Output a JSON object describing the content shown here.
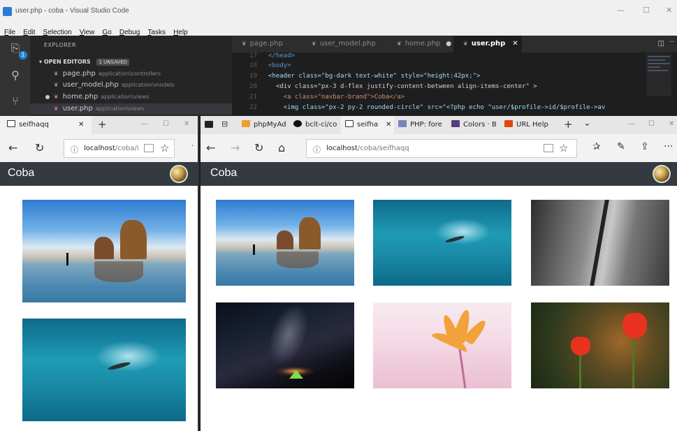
{
  "vscode": {
    "title": "user.php - coba - Visual Studio Code",
    "window_controls": [
      "—",
      "☐",
      "✕"
    ],
    "menu": [
      "File",
      "Edit",
      "Selection",
      "View",
      "Go",
      "Debug",
      "Tasks",
      "Help"
    ],
    "activity_badge": "1",
    "explorer": {
      "header": "EXPLORER",
      "section": "OPEN EDITORS",
      "unsaved_badge": "1 UNSAVED",
      "files": [
        {
          "name": "page.php",
          "path": "application\\controllers"
        },
        {
          "name": "user_model.php",
          "path": "application\\models"
        },
        {
          "name": "home.php",
          "path": "application\\views"
        },
        {
          "name": "user.php",
          "path": "application\\views"
        }
      ]
    },
    "tabs": [
      {
        "label": "page.php"
      },
      {
        "label": "user_model.php"
      },
      {
        "label": "home.php",
        "modified_marker": "●"
      },
      {
        "label": "user.php",
        "close_marker": "✕"
      }
    ],
    "code_lines": [
      {
        "num": "17",
        "code": "</head>"
      },
      {
        "num": "18",
        "code": "<body>"
      },
      {
        "num": "19",
        "code": "<header class=\"bg-dark text-white\" style=\"height:42px;\">"
      },
      {
        "num": "20",
        "code": "  <div class=\"px-3 d-flex justify-content-between align-items-center\" >"
      },
      {
        "num": "21",
        "code": "    <a class=\"navbar-brand\">Coba</a>"
      },
      {
        "num": "22",
        "code": "    <img class=\"px-2 py-2 rounded-circle\" src=\"<?php echo \"user/$profile->id/$profile->av"
      }
    ]
  },
  "left_browser": {
    "tab_title": "seifhaqq",
    "new_tab": "+",
    "window_controls": [
      "—",
      "☐",
      "✕"
    ],
    "address_host": "localhost",
    "address_path": "/coba/i",
    "navbar_brand": "Coba"
  },
  "right_browser": {
    "tabs": [
      "phpMyAd",
      "bcit-ci/co",
      "seifha",
      "PHP: fore",
      "Colors · B",
      "URL Help"
    ],
    "active_tab_close": "✕",
    "new_tab": "+",
    "tab_dropdown": "⌄",
    "window_controls": [
      "—",
      "☐",
      "✕"
    ],
    "address_host": "localhost",
    "address_path": "/coba/seifhaqq",
    "navbar_brand": "Coba",
    "more": "···"
  },
  "colors": {
    "navbar": "#343a40",
    "vscode_bg": "#1e1e1e",
    "vscode_sidebar": "#252526",
    "php_icon": "#c586c0"
  }
}
